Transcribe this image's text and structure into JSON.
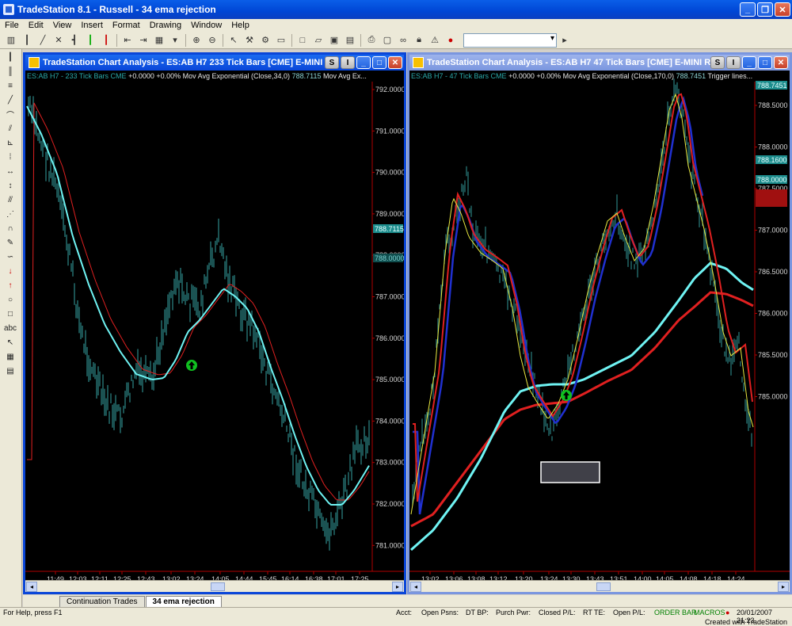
{
  "app": {
    "title": "TradeStation 8.1 - Russell - 34 ema rejection",
    "menu": [
      "File",
      "Edit",
      "View",
      "Insert",
      "Format",
      "Drawing",
      "Window",
      "Help"
    ]
  },
  "icons": {
    "toolbar": [
      "bar-chart-icon",
      "pen-icon",
      "insert-chart-icon",
      "zoom-in-icon",
      "zoom-out-icon",
      "pointer-icon",
      "tools-icon",
      "new-icon",
      "open-icon",
      "save-icon",
      "print-icon",
      "lock-icon",
      "color-icon"
    ],
    "left": [
      "cursor-icon",
      "bar-icon",
      "line-icon",
      "trendline-icon",
      "fib-icon",
      "arrow-icon",
      "circle-icon",
      "rectangle-icon",
      "text-icon"
    ]
  },
  "chart1": {
    "title": "TradeStation Chart Analysis - ES:AB H7  233 Tick Bars [CME] E-MINI R...",
    "status_symbol": "ES:AB H7 - 233 Tick Bars  CME",
    "status_change": "+0.0000  +0.00%",
    "status_study": "Mov Avg Exponential  (Close,34,0)",
    "status_value": "788.7115",
    "status_tail": "Mov Avg Ex...",
    "ylabels": [
      "792.0000",
      "791.0000",
      "790.0000",
      "789.0000",
      "788.0000",
      "787.0000",
      "786.0000",
      "785.0000",
      "784.0000",
      "783.0000",
      "782.0000",
      "781.0000"
    ],
    "xlabels": [
      "11:49",
      "12:03",
      "12:11",
      "12:25",
      "12:43",
      "13:02",
      "13:24",
      "14:05",
      "14:44",
      "15:45",
      "16:14",
      "16:38",
      "17:01",
      "17:25"
    ],
    "price_tag": "788.7115",
    "price_tag2": "788.0000"
  },
  "chart2": {
    "title": "TradeStation Chart Analysis - ES:AB H7  47 Tick Bars [CME] E-MINI RU...",
    "status_symbol": "ES:AB H7 - 47 Tick Bars  CME",
    "status_change": "+0.0000  +0.00%",
    "status_study": "Mov Avg Exponential  (Close,170,0)",
    "status_value": "788.7451",
    "status_tail": "Trigger lines...",
    "ylabels": [
      "788.5000",
      "788.0000",
      "787.5000",
      "787.0000",
      "786.5000",
      "786.0000",
      "785.5000",
      "785.0000"
    ],
    "xlabels": [
      "13:02",
      "13:06",
      "13:08",
      "13:12",
      "13:20",
      "13:24",
      "13:30",
      "13:43",
      "13:51",
      "14:00",
      "14:05",
      "14:08",
      "14:18",
      "14:24"
    ],
    "price_tags": [
      "788.7451",
      "788.1600",
      "788.0000"
    ]
  },
  "tabs": [
    "Continuation Trades",
    "34 ema rejection"
  ],
  "statusbar": {
    "help": "For Help, press F1",
    "acct": "Acct:",
    "open_psns": "Open Psns:",
    "dt_bp": "DT BP:",
    "purch_pwr": "Purch Pwr:",
    "closed_pl": "Closed P/L:",
    "rt_te": "RT TE:",
    "open_pl": "Open P/L:",
    "order_bar": "ORDER BAR",
    "macros": "MACROS",
    "datetime": "20/01/2007 21:23",
    "credit": "Created with TradeStation"
  },
  "colors": {
    "chart_bg": "#000000",
    "bars": "#2a7f7f",
    "ema_cyan": "#6ff3f3",
    "ema_red": "#e02020",
    "trigger_yellow": "#e8e840",
    "trigger_blue": "#2030d0",
    "signal_green": "#10c020"
  }
}
